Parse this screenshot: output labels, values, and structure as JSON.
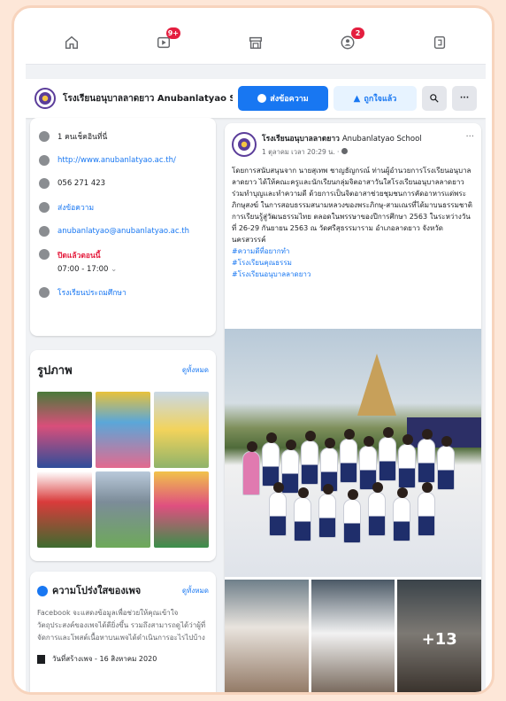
{
  "nav": {
    "video_badge": "9+",
    "groups_badge": "2"
  },
  "pagebar": {
    "name": "โรงเรียนอนุบาลลาดยาว Anubanlatyao Sch...",
    "message_label": "ส่งข้อความ",
    "like_label": "ถูกใจแล้ว",
    "more_label": "···"
  },
  "about": {
    "checkins": "1 คนเช็คอินที่นี่",
    "website": "http://www.anubanlatyao.ac.th/",
    "phone": "056 271 423",
    "messenger": "ส่งข้อความ",
    "email": "anubanlatyao@anubanlatyao.ac.th",
    "status": "ปิดแล้วตอนนี้",
    "hours": "07:00 - 17:00",
    "hours_chevron": "⌄",
    "category": "โรงเรียนประถมศึกษา"
  },
  "photos": {
    "title": "รูปภาพ",
    "see_all": "ดูทั้งหมด"
  },
  "transparency": {
    "title": "ความโปร่งใสของเพจ",
    "see_all": "ดูทั้งหมด",
    "description": "Facebook จะแสดงข้อมูลเพื่อช่วยให้คุณเข้าใจวัตถุประสงค์ของเพจได้ดียิ่งขึ้น รวมถึงสามารถดูได้ว่าผู้ที่จัดการและโพสต์เนื้อหาบนเพจได้ดำเนินการอะไรไปบ้าง",
    "created": "วันที่สร้างเพจ - 16 สิงหาคม 2020"
  },
  "post": {
    "author": "โรงเรียนอนุบาลลาดยาว",
    "author_en": "Anubanlatyao School",
    "time": "1 ตุลาคม เวลา 20:29 น. · ",
    "more": "···",
    "body": "โดยการสนับสนุนจาก นายสุเทพ ชาญธัญกรณ์ ท่านผู้อำนวยการโรงเรียนอนุบาลลาดยาว ได้ให้คณะครูและนักเรียนกลุ่มจิตอาสาวันใสโรงเรียนอนุบาลลาดยาวร่วมทำบุญและทำความดี ด้วยการเป็นจิตอาสาช่วยชุมชนการคัดอาหารแด่พระภิกษุสงฆ์ ในการสอบธรรมสนามหลวงของพระภิกษุ-สามเณรที่ได้มาบนธรรมชาติการเรียนรู้สู่วัฒนธรรมไทย ตลอดในพรรษาของปีการศึกษา 2563 ในระหว่างวันที่ 26-29 กันยายน 2563 ณ วัดศรีสุธรรมาราม อำเภอลาดยาว จังหวัดนครสวรรค์",
    "tags": [
      "#ความดีที่อยากทำ",
      "#โรงเรียนคุณธรรม",
      "#โรงเรียนอนุบาลลาดยาว"
    ],
    "more_photos": "+13"
  },
  "colors": {
    "facebook_blue": "#1877f2",
    "badge_red": "#e41e3f",
    "frame_peach": "#fde7d8"
  }
}
